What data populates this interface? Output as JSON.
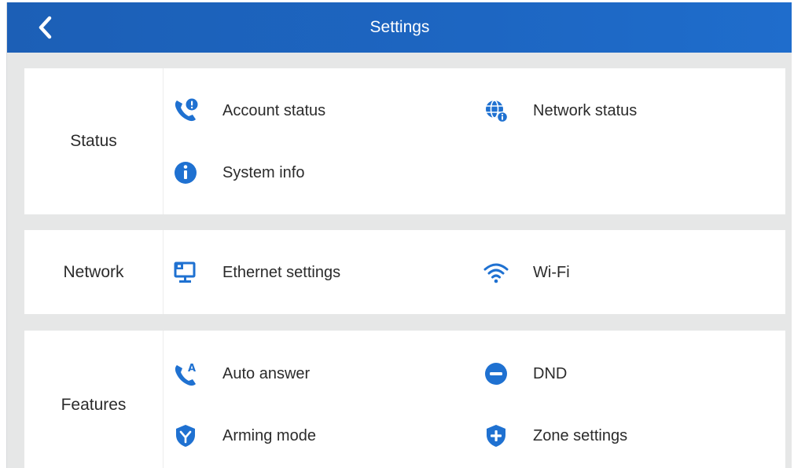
{
  "header": {
    "title": "Settings"
  },
  "colors": {
    "header_blue": "#1d66c2",
    "icon_blue": "#1f71d1",
    "panel_bg": "#e6e7e7"
  },
  "sections": {
    "status": {
      "label": "Status",
      "items": [
        {
          "label": "Account status",
          "icon": "phone-alert-icon"
        },
        {
          "label": "Network status",
          "icon": "globe-info-icon"
        },
        {
          "label": "System info",
          "icon": "info-circle-icon"
        }
      ]
    },
    "network": {
      "label": "Network",
      "items": [
        {
          "label": "Ethernet settings",
          "icon": "ethernet-icon"
        },
        {
          "label": "Wi-Fi",
          "icon": "wifi-icon"
        }
      ]
    },
    "features": {
      "label": "Features",
      "items": [
        {
          "label": "Auto answer",
          "icon": "auto-answer-icon"
        },
        {
          "label": "DND",
          "icon": "dnd-icon"
        },
        {
          "label": "Arming mode",
          "icon": "arming-shield-icon"
        },
        {
          "label": "Zone settings",
          "icon": "zone-shield-icon"
        }
      ]
    }
  }
}
